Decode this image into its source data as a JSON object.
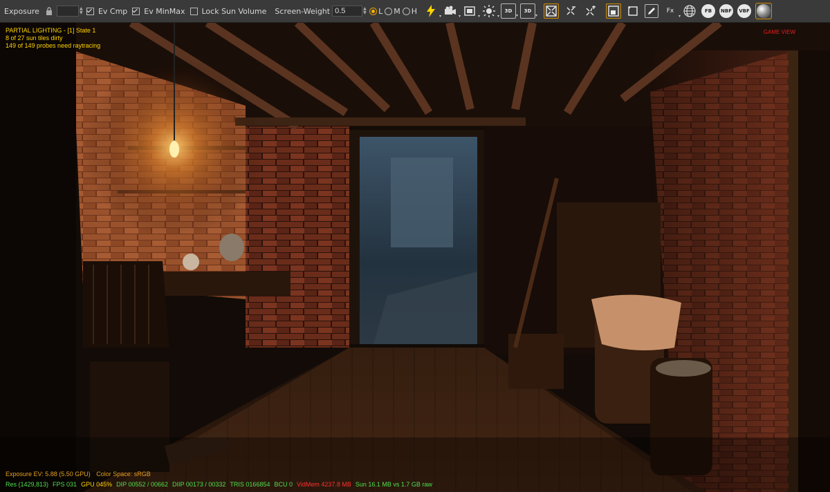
{
  "toolbar": {
    "exposure_label": "Exposure",
    "exposure_value": "",
    "ev_cmp_label": "Ev Cmp",
    "ev_minmax_label": "Ev MinMax",
    "lock_sun_label": "Lock Sun Volume",
    "screen_weight_label": "Screen-Weight",
    "screen_weight_value": "0.5",
    "quality_l": "L",
    "quality_m": "M",
    "quality_h": "H",
    "fx_label": "Fx",
    "fb_label": "FB",
    "nbf_label": "NBF",
    "vbf_label": "VBF",
    "tag_3d": "3D"
  },
  "overlay": {
    "lighting_title": "PARTIAL LIGHTING - [1] State 1",
    "sun_tiles": "8 of 27 sun tiles dirty",
    "probes": "149 of 149 probes need raytracing",
    "game_view": "GAME VIEW",
    "exposure_info": "Exposure EV: 5.88 (5.50 GPU)",
    "color_space": "Color Space: sRGB",
    "stats": {
      "res": "Res (1429,813)",
      "fps": "FPS 031",
      "gpu": "GPU 045%",
      "dip": "DIP 00552 / 00662",
      "diip": "DIIP 00173 / 00332",
      "tris": "TRIS 0166854",
      "bcu": "BCU 0",
      "vidmem": "VidMem 4237.8 MB",
      "sun": "Sun 16.1 MB vs 1.7 GB raw"
    }
  },
  "colors": {
    "overlay_yellow": "#ffd400",
    "overlay_orange": "#e6a020",
    "stat_green": "#4fe04f",
    "stat_red": "#ff3030",
    "accent": "#ffb000"
  }
}
